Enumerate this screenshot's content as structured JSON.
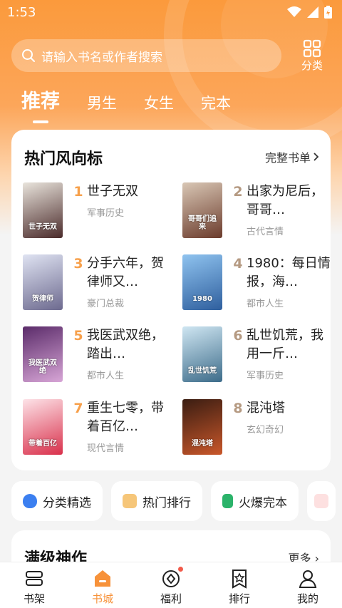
{
  "status": {
    "time": "1:53"
  },
  "search": {
    "placeholder": "请输入书名或作者搜索"
  },
  "category_button": {
    "label": "分类"
  },
  "tabs": [
    {
      "label": "推荐",
      "active": true
    },
    {
      "label": "男生",
      "active": false
    },
    {
      "label": "女生",
      "active": false
    },
    {
      "label": "完本",
      "active": false
    }
  ],
  "hot": {
    "title": "热门风向标",
    "more": "完整书单",
    "books": [
      {
        "rank": "1",
        "title": "世子无双",
        "category": "军事历史",
        "cover_text": "世子无双",
        "cover_colors": [
          "#e9e4dc",
          "#4a2a2a"
        ]
      },
      {
        "rank": "2",
        "title": "出家为尼后，哥哥…",
        "category": "古代言情",
        "cover_text": "哥哥们追来",
        "cover_colors": [
          "#d9c7b5",
          "#6b3b2c"
        ]
      },
      {
        "rank": "3",
        "title": "分手六年，贺律师又…",
        "category": "豪门总裁",
        "cover_text": "贺律师",
        "cover_colors": [
          "#dfe3f2",
          "#6d6a8f"
        ]
      },
      {
        "rank": "4",
        "title": "1980：每日情报，海…",
        "category": "都市人生",
        "cover_text": "1980",
        "cover_colors": [
          "#8fc3ef",
          "#2f5f9e"
        ]
      },
      {
        "rank": "5",
        "title": "我医武双绝，踏出…",
        "category": "都市人生",
        "cover_text": "我医武双绝",
        "cover_colors": [
          "#5b2c6a",
          "#d7a5d6"
        ]
      },
      {
        "rank": "6",
        "title": "乱世饥荒，我用一斤…",
        "category": "军事历史",
        "cover_text": "乱世饥荒",
        "cover_colors": [
          "#cfe6f2",
          "#3d6c8a"
        ]
      },
      {
        "rank": "7",
        "title": "重生七零，带着百亿…",
        "category": "现代言情",
        "cover_text": "带着百亿",
        "cover_colors": [
          "#fde3e8",
          "#d9304b"
        ]
      },
      {
        "rank": "8",
        "title": "混沌塔",
        "category": "玄幻奇幻",
        "cover_text": "混沌塔",
        "cover_colors": [
          "#3a1d12",
          "#c9572a"
        ]
      }
    ]
  },
  "chips": [
    {
      "label": "分类精选",
      "color": "#3b7ff0"
    },
    {
      "label": "热门排行",
      "color": "#f3a23a"
    },
    {
      "label": "火爆完本",
      "color": "#2bb36a"
    }
  ],
  "section2": {
    "title": "满级神作",
    "more": "更多"
  },
  "nav": [
    {
      "label": "书架",
      "icon": "bookshelf-icon",
      "active": false
    },
    {
      "label": "书城",
      "icon": "bookstore-icon",
      "active": true
    },
    {
      "label": "福利",
      "icon": "welfare-icon",
      "active": false
    },
    {
      "label": "排行",
      "icon": "ranking-icon",
      "active": false
    },
    {
      "label": "我的",
      "icon": "profile-icon",
      "active": false
    }
  ],
  "colors": {
    "accent": "#f7923a",
    "rank": "#f7a04b"
  }
}
